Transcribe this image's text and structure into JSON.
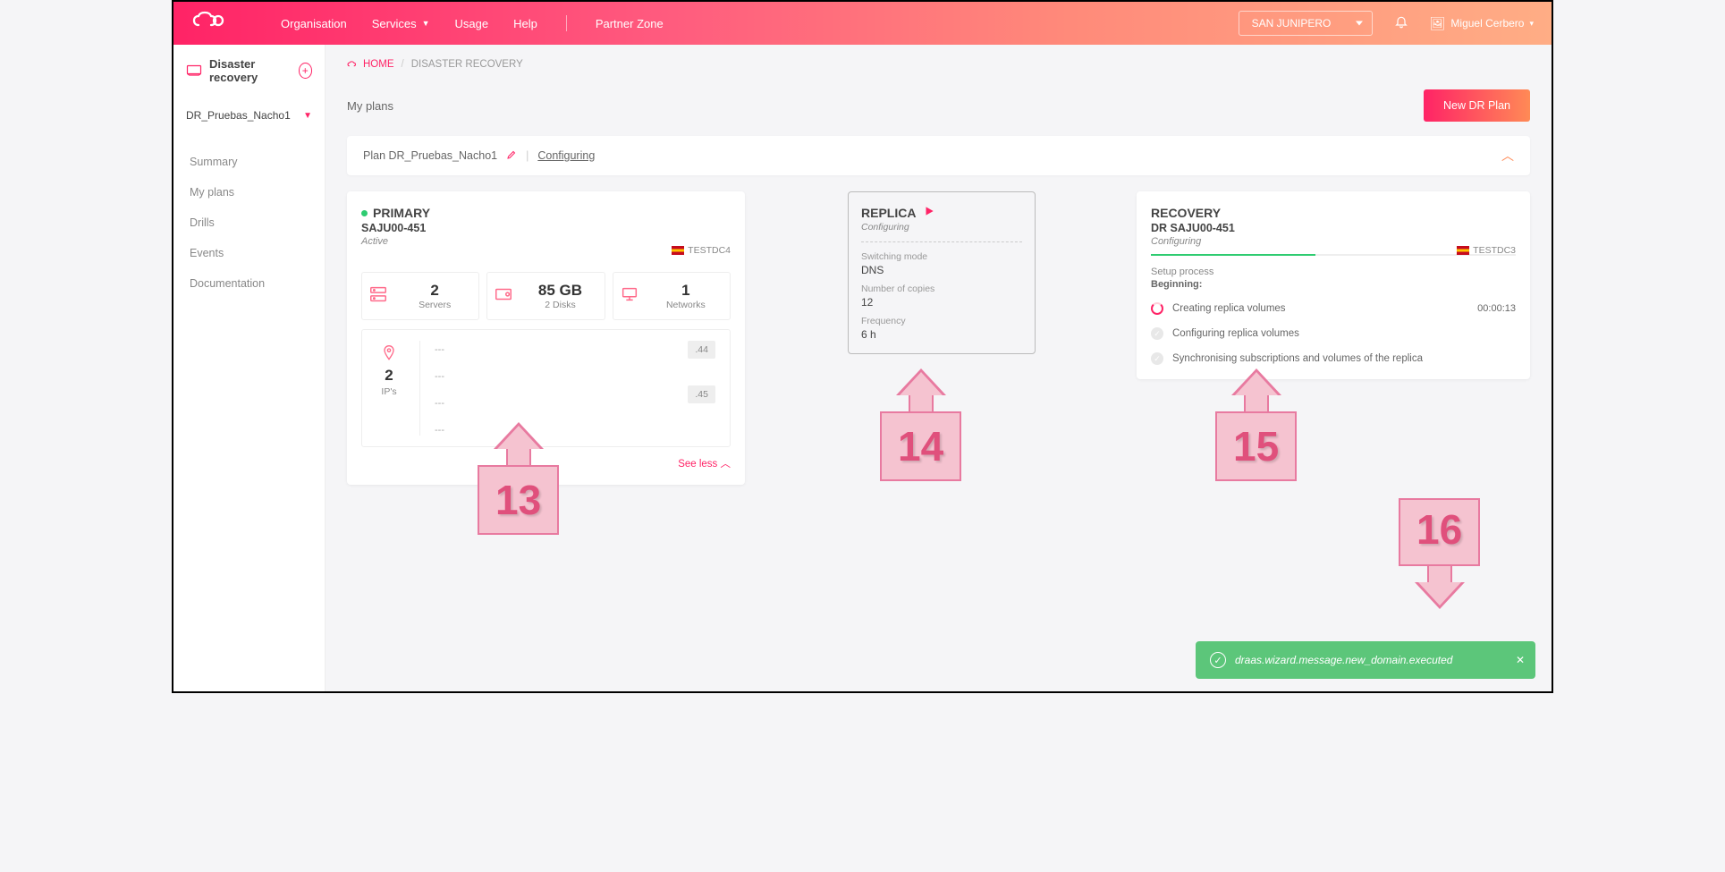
{
  "topbar": {
    "nav": {
      "org": "Organisation",
      "services": "Services",
      "usage": "Usage",
      "help": "Help",
      "partner": "Partner Zone"
    },
    "tenant": "SAN JUNIPERO",
    "user": "Miguel Cerbero"
  },
  "sidebar": {
    "title": "Disaster recovery",
    "selectedPlan": "DR_Pruebas_Nacho1",
    "menu": {
      "summary": "Summary",
      "myplans": "My plans",
      "drills": "Drills",
      "events": "Events",
      "docs": "Documentation"
    }
  },
  "breadcrumb": {
    "home": "HOME",
    "page": "DISASTER RECOVERY"
  },
  "pageTitle": "My plans",
  "newPlanBtn": "New DR Plan",
  "planbar": {
    "label": "Plan DR_Pruebas_Nacho1",
    "status": "Configuring"
  },
  "primary": {
    "title": "PRIMARY",
    "vdc": "SAJU00-451",
    "status": "Active",
    "dc": "TESTDC4",
    "servers_v": "2",
    "servers_l": "Servers",
    "storage_v": "85 GB",
    "storage_l": "2 Disks",
    "nets_v": "1",
    "nets_l": "Networks",
    "ips_v": "2",
    "ips_l": "IP's",
    "ip_gw1": "---",
    "ip_gw2": "---",
    "ip_gw3": "---",
    "ip_gw4": "---",
    "chip1": ".44",
    "chip2": ".45",
    "seeLess": "See less"
  },
  "replica": {
    "title": "REPLICA",
    "status": "Configuring",
    "mode_k": "Switching mode",
    "mode_v": "DNS",
    "copies_k": "Number of copies",
    "copies_v": "12",
    "freq_k": "Frequency",
    "freq_v": "6 h"
  },
  "recovery": {
    "title": "RECOVERY",
    "vdc": "DR SAJU00-451",
    "status": "Configuring",
    "dc": "TESTDC3",
    "setup_k": "Setup process",
    "setup_v": "Beginning:",
    "step1": "Creating replica volumes",
    "step1_time": "00:00:13",
    "step2": "Configuring replica volumes",
    "step3": "Synchronising subscriptions and volumes of the replica"
  },
  "annotations": {
    "a13": "13",
    "a14": "14",
    "a15": "15",
    "a16": "16"
  },
  "toast": {
    "msg": "draas.wizard.message.new_domain.executed"
  }
}
